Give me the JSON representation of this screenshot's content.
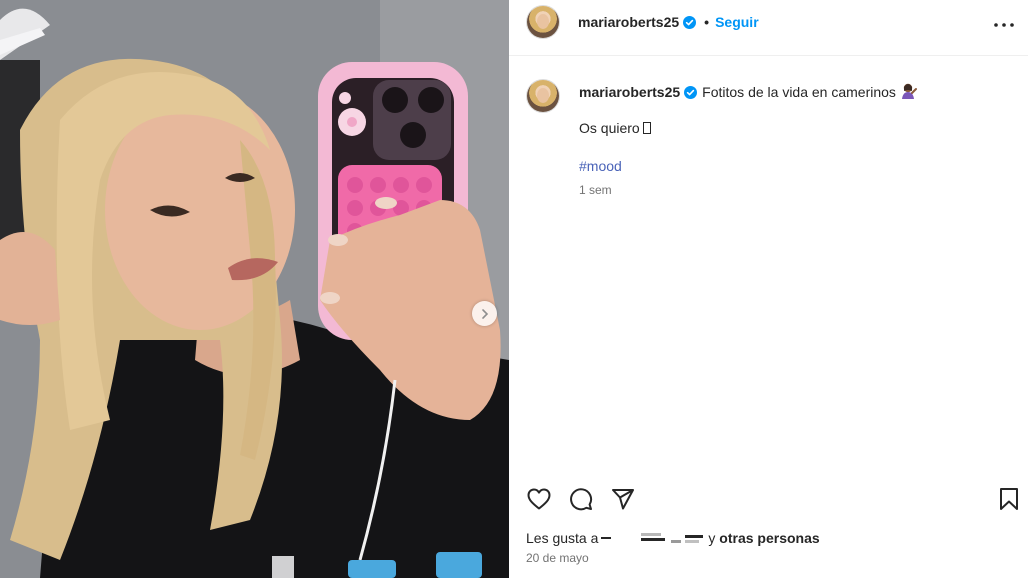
{
  "post": {
    "username": "mariaroberts25",
    "follow_label": "Seguir",
    "separator": "•",
    "caption": "Fotitos de la vida en camerinos",
    "caption_line2": "Os quiero",
    "hashtag": "#mood",
    "relative_time": "1 sem",
    "likes_prefix": "Les gusta a",
    "likes_joiner": "y",
    "likes_suffix": "otras personas",
    "date": "20 de mayo"
  },
  "icons": {
    "verified": "verified-badge-icon",
    "more": "more-options-icon",
    "like": "heart-icon",
    "comment": "comment-icon",
    "share": "paper-plane-icon",
    "save": "bookmark-icon",
    "next": "chevron-right-icon",
    "caption_emoji": "woman-tipping-hand-emoji"
  },
  "colors": {
    "accent": "#0095f6",
    "hashtag": "#4a63b8",
    "secondary_text": "#737373",
    "phone_case": "#f3b9d4",
    "popit": "#f06aa8"
  }
}
